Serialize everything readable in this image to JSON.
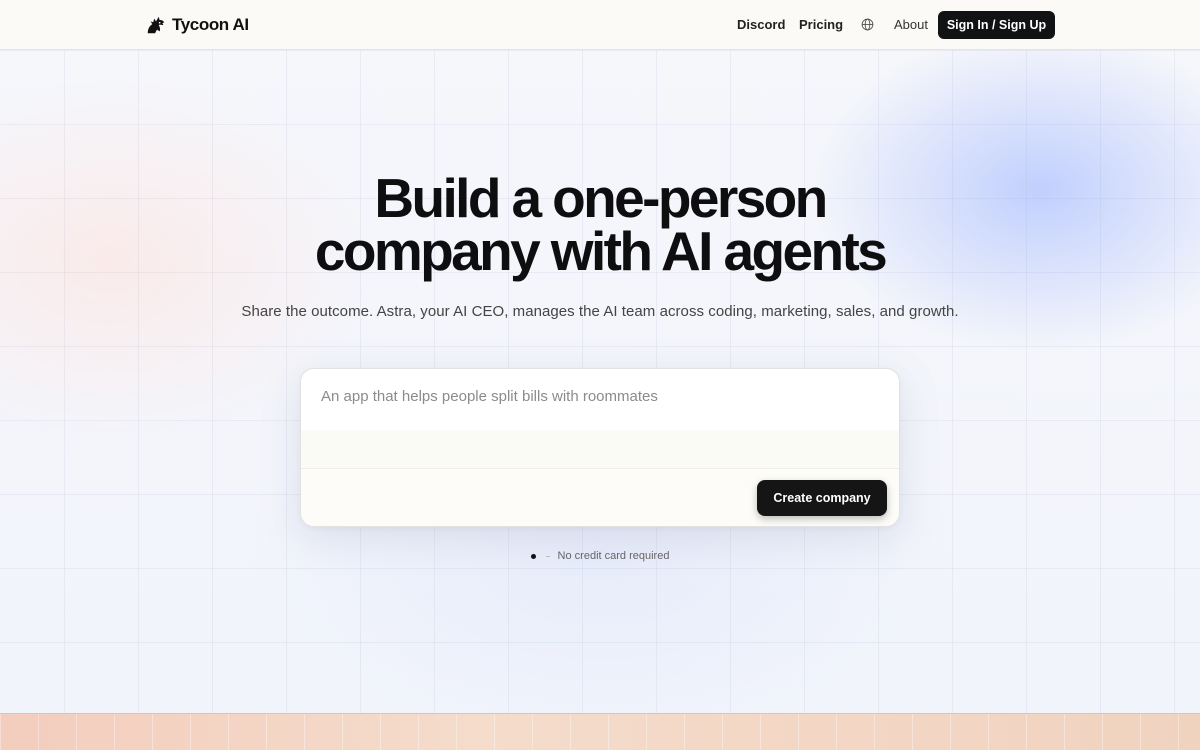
{
  "nav": {
    "brand": "Tycoon AI",
    "brand_icon": "horse-head-icon",
    "links": {
      "discord": "Discord",
      "pricing": "Pricing",
      "about": "About"
    },
    "language_icon": "globe-icon",
    "cta": "Sign In / Sign Up"
  },
  "hero": {
    "title_line1": "Build a one-person",
    "title_line2": "company with AI agents",
    "subtitle": "Share the outcome. Astra, your AI CEO, manages the AI team across coding, marketing, sales, and growth."
  },
  "prompt": {
    "placeholder": "An app that helps people split bills with roommates",
    "value": "",
    "submit_label": "Create company"
  },
  "note": {
    "text": "No credit card required"
  },
  "colors": {
    "primary_button": "#111214",
    "nav_background": "#fbfaf7",
    "accent_glow": "#96afff"
  }
}
